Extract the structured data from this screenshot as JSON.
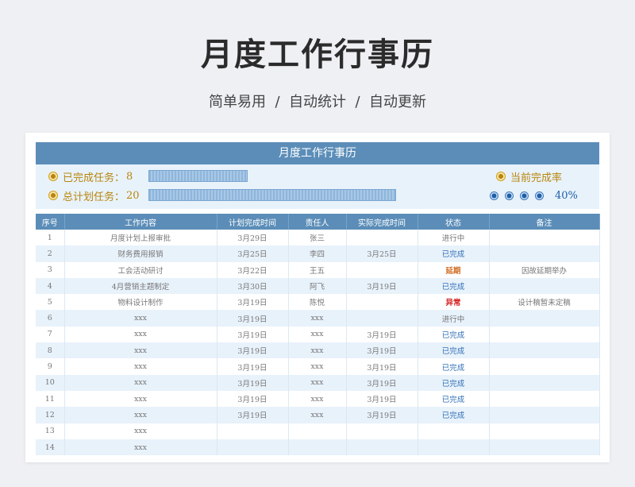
{
  "hero": {
    "title": "月度工作行事历",
    "subtitle": "简单易用  /  自动统计  /  自动更新"
  },
  "sheet": {
    "title": "月度工作行事历",
    "summary": {
      "completed_label": "已完成任务：",
      "completed_value": "8",
      "total_label": "总计划任务：",
      "total_value": "20",
      "rate_label": "当前完成率",
      "rate_value": "40%",
      "rate_fraction": 0.4
    },
    "columns": [
      "序号",
      "工作内容",
      "计划完成时间",
      "责任人",
      "实际完成时间",
      "状态",
      "备注"
    ],
    "rows": [
      [
        "1",
        "月度计划上报审批",
        "3月29日",
        "张三",
        "",
        "进行中",
        ""
      ],
      [
        "2",
        "财务费用报销",
        "3月25日",
        "李四",
        "3月25日",
        "已完成",
        ""
      ],
      [
        "3",
        "工会活动研讨",
        "3月22日",
        "王五",
        "",
        "延期",
        "因故延期举办"
      ],
      [
        "4",
        "4月营销主题制定",
        "3月30日",
        "阿飞",
        "3月19日",
        "已完成",
        ""
      ],
      [
        "5",
        "物料设计制作",
        "3月19日",
        "陈悦",
        "",
        "异常",
        "设计稿暂未定稿"
      ],
      [
        "6",
        "xxx",
        "3月19日",
        "xxx",
        "",
        "进行中",
        ""
      ],
      [
        "7",
        "xxx",
        "3月19日",
        "xxx",
        "3月19日",
        "已完成",
        ""
      ],
      [
        "8",
        "xxx",
        "3月19日",
        "xxx",
        "3月19日",
        "已完成",
        ""
      ],
      [
        "9",
        "xxx",
        "3月19日",
        "xxx",
        "3月19日",
        "已完成",
        ""
      ],
      [
        "10",
        "xxx",
        "3月19日",
        "xxx",
        "3月19日",
        "已完成",
        ""
      ],
      [
        "11",
        "xxx",
        "3月19日",
        "xxx",
        "3月19日",
        "已完成",
        ""
      ],
      [
        "12",
        "xxx",
        "3月19日",
        "xxx",
        "3月19日",
        "已完成",
        ""
      ],
      [
        "13",
        "xxx",
        "",
        "",
        "",
        "",
        ""
      ],
      [
        "14",
        "xxx",
        "",
        "",
        "",
        "",
        ""
      ]
    ]
  },
  "colors": {
    "header_blue": "#5b8db8",
    "accent_gold": "#b8860b",
    "status_done": "#2f6fb4",
    "status_late": "#d2691e",
    "status_error": "#d42020"
  }
}
